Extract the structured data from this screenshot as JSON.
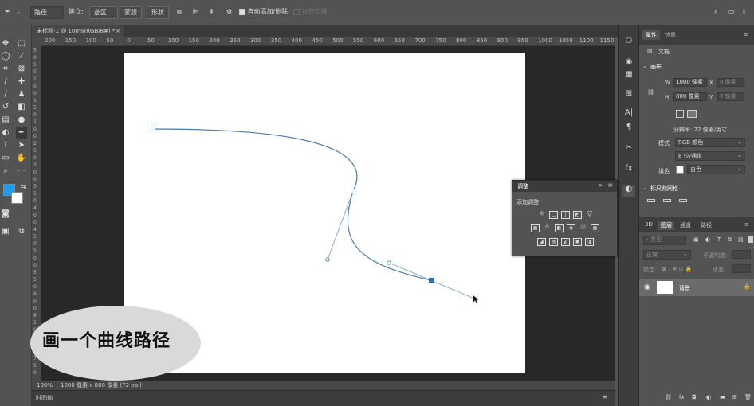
{
  "options_bar": {
    "mode": "路径",
    "make_label": "建立:",
    "selection_btn": "选区...",
    "mask_btn": "蒙版",
    "shape_btn": "形状",
    "auto_add_delete": "自动添加/删除",
    "align_edges": "对齐边缘"
  },
  "document": {
    "tab_title": "未标题-1 @ 100%(RGB/8#) *",
    "zoom": "100%",
    "status": "1000 像素 x 800 像素 (72 ppi)"
  },
  "ruler": {
    "h_ticks": [
      "200",
      "150",
      "100",
      "50",
      "0",
      "50",
      "100",
      "150",
      "200",
      "250",
      "300",
      "350",
      "400",
      "450",
      "500",
      "550",
      "600",
      "650",
      "700",
      "750",
      "800",
      "850",
      "900",
      "950",
      "1000",
      "1050",
      "1100",
      "1150"
    ],
    "v_ticks": [
      "5",
      "0",
      "5",
      "0",
      "1",
      "0",
      "0",
      "1",
      "5",
      "0",
      "2",
      "0",
      "0",
      "2",
      "5",
      "0",
      "3",
      "0",
      "0",
      "3",
      "5",
      "0",
      "4",
      "0",
      "0",
      "4",
      "5",
      "0",
      "5",
      "0",
      "0",
      "5",
      "5",
      "0",
      "6",
      "0",
      "0",
      "6",
      "5",
      "0",
      "7",
      "0",
      "0",
      "7",
      "5",
      "0"
    ]
  },
  "timeline": {
    "label": "时间轴"
  },
  "callout": {
    "text": "画一个曲线路径"
  },
  "properties": {
    "tab_properties": "属性",
    "tab_info": "信息",
    "doc_label": "文档",
    "canvas_section": "画布",
    "w_label": "W",
    "w_value": "1000 像素",
    "h_label": "H",
    "h_value": "800 像素",
    "x_label": "X",
    "y_label": "Y",
    "x_placeholder": "0 像素",
    "y_placeholder": "0 像素",
    "resolution": "分辨率: 72 像素/英寸",
    "mode_label": "模式",
    "mode_value": "RGB 颜色",
    "depth_value": "8 位/通道",
    "fill_label": "填色",
    "fill_value": "白色",
    "rulers_grids": "标尺和网格"
  },
  "layers": {
    "tab_3d": "3D",
    "tab_layers": "图层",
    "tab_channels": "通道",
    "tab_paths": "路径",
    "kind_placeholder": "类型",
    "blend_mode": "正常",
    "opacity_label": "不透明度:",
    "lock_label": "锁定:",
    "fill_label": "填充:",
    "layer_name": "背景"
  },
  "adjustments": {
    "tab": "调整",
    "add_label": "添加调整"
  },
  "colors": {
    "foreground": "#1a9bef",
    "background": "#ffffff",
    "path_stroke": "#4a7aa8",
    "bubble": "#d9d9d9"
  }
}
